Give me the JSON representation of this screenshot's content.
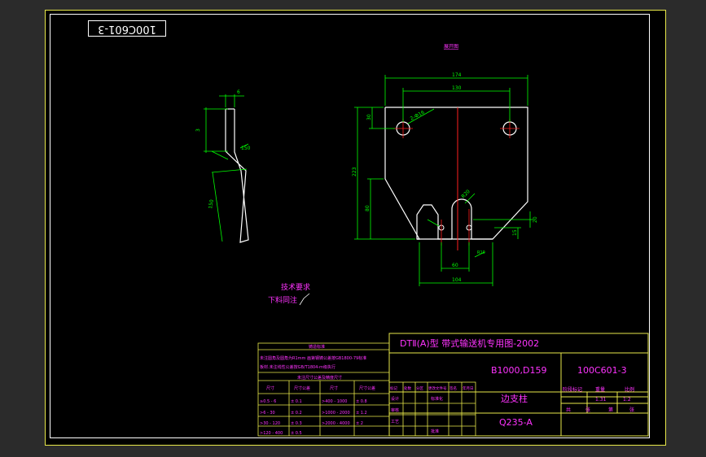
{
  "colors": {
    "background": "#000000",
    "frame": "#e8e84a",
    "line": "#ffffff",
    "dimension": "#00ff00",
    "text": "#ff33ff",
    "center": "#ff2020",
    "title": "#ffff66"
  },
  "doc_code_rotated": "100C601-3",
  "view_title": "展开图",
  "dimensions": {
    "total_width": "174",
    "hole_spacing": "130",
    "top_offset": "30",
    "hole_diameter": "2-Ф16",
    "total_height": "223",
    "lower_height": "80",
    "slot_right": "20",
    "slot_small": "15",
    "bottom_width": "60",
    "base_width": "104",
    "slot_radius": "R20",
    "chamfer_right": "R10",
    "side_top": "6",
    "side_upper": "3",
    "side_mid": "150",
    "side_angle": "",
    "side_lower": "150"
  },
  "notes": {
    "heading": "技术要求",
    "item": "下料同注"
  },
  "title_block": {
    "main_title": "DTⅡ(A)型  带式输送机专用图-2002",
    "spec": "B1000,D159",
    "drawing_no": "100C601-3",
    "part_name": "边支柱",
    "material": "Q235-A",
    "stage_label": "阶段标记",
    "weight_label": "重量",
    "scale_label": "比例",
    "weight_value": "1.31",
    "scale_value": "1:2",
    "sheet_total": "共",
    "sheet_label": "张",
    "sheet_no": "第",
    "sheet_label2": "张"
  },
  "rev_block": {
    "header": "铸造标准",
    "line1": "未注圆角及圆角为R1mm  画第钢铸公差按GB1800-79标准",
    "line2": "板材.未注线性公差按GB/T1804-m级执行",
    "tol_title": "未注尺寸公差及精度尺寸",
    "col1": "尺寸",
    "col2": "尺寸公差",
    "col3": "尺寸",
    "col4": "尺寸公差",
    "rows": [
      [
        "≥0.5 - 6",
        "± 0.1",
        ">400 - 1000",
        "± 0.8"
      ],
      [
        ">6 - 30",
        "± 0.2",
        ">1000 - 2000",
        "± 1.2"
      ],
      [
        ">30 - 120",
        "± 0.3",
        ">2000 - 4000",
        "± 2"
      ],
      [
        ">120 - 400",
        "± 0.5",
        "",
        ""
      ]
    ],
    "sign_cols": [
      "标记",
      "处数",
      "分区",
      "更改文件号",
      "签名",
      "年月日"
    ],
    "sign_rows": [
      "设计",
      "审核",
      "工艺"
    ],
    "std_label": "标准化",
    "approve_label": "批准"
  }
}
